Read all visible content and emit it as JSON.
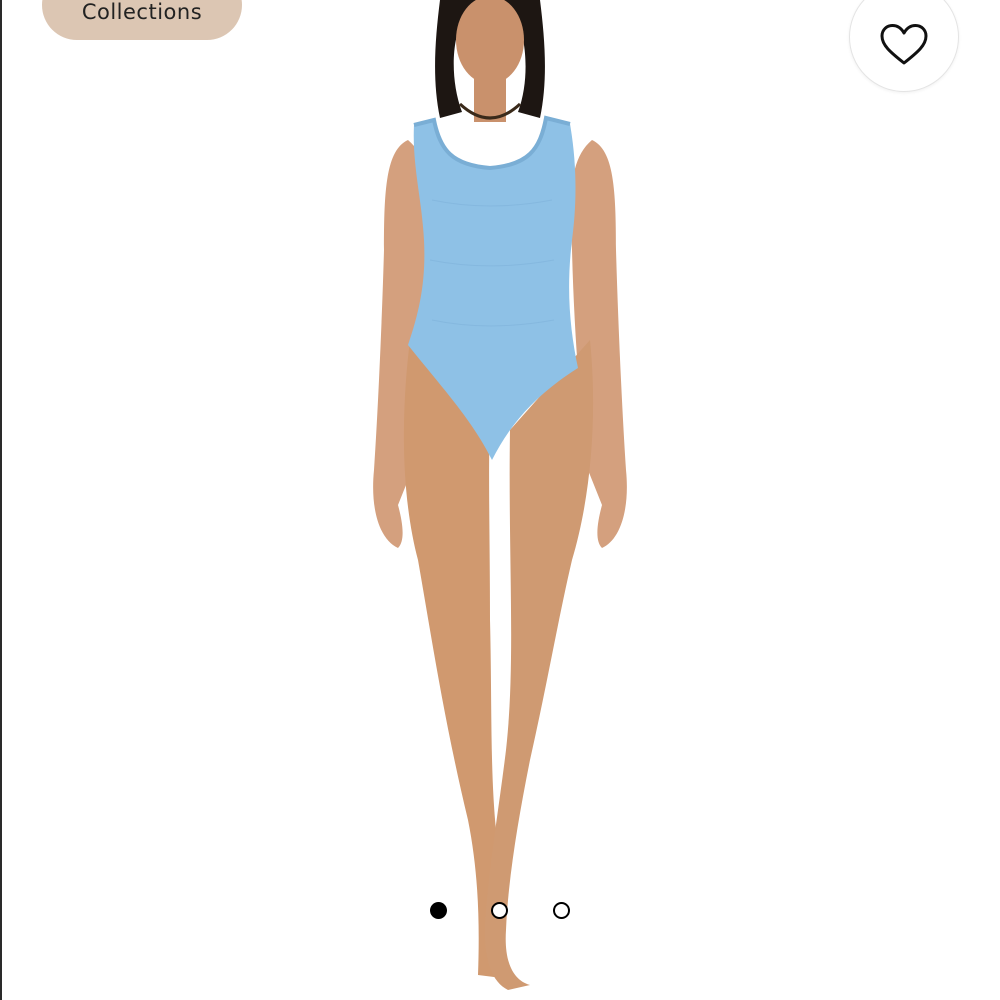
{
  "header": {
    "collections_label": "Collections"
  },
  "actions": {
    "like_icon": "heart-outline-icon"
  },
  "product": {
    "image_subject": "model-in-light-blue-swimsuit",
    "swimsuit_color": "#8ec1e6",
    "skin_color": "#d4a07e"
  },
  "carousel": {
    "total_slides": 3,
    "active_index": 0
  },
  "colors": {
    "chip_background": "#dcc6b3",
    "dot_active": "#000000",
    "dot_border": "#000000"
  }
}
